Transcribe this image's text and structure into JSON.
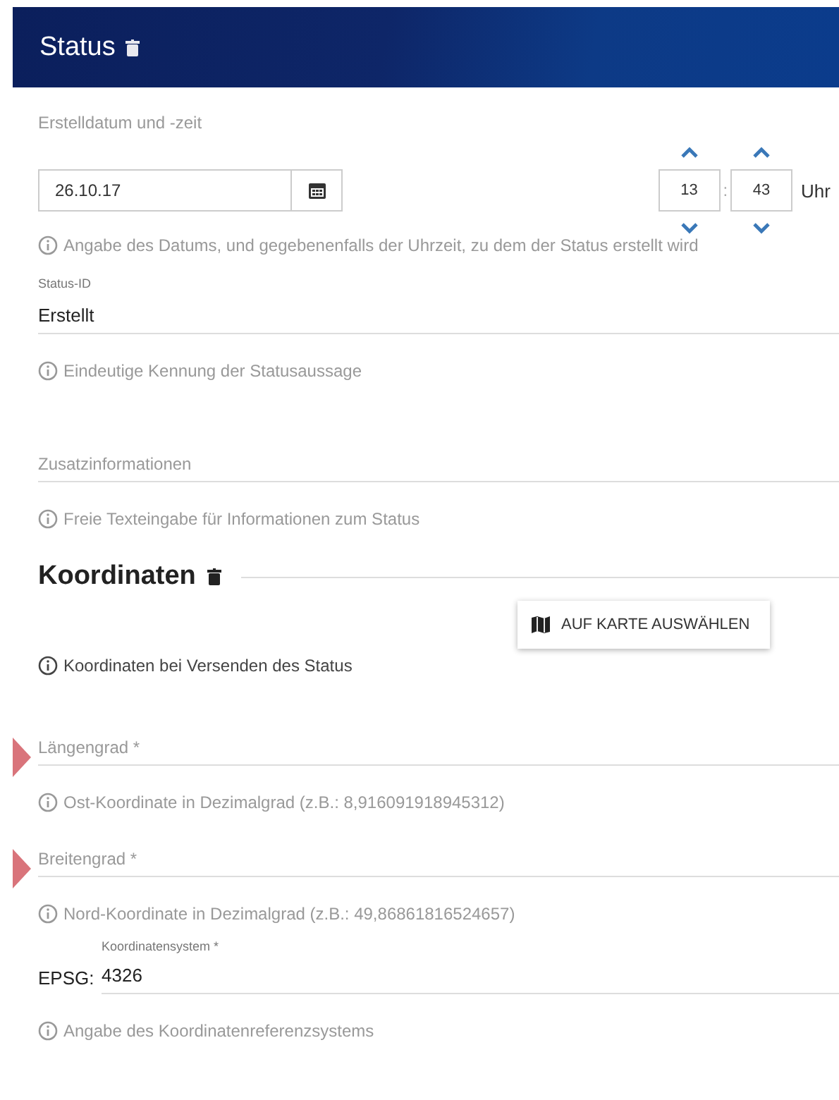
{
  "header": {
    "title": "Status"
  },
  "fields": [
    {
      "kind": "datetime",
      "label": "Erstelldatum und -zeit",
      "date": "26.10.17",
      "hour": "13",
      "separator": ":",
      "minute": "43",
      "unit": "Uhr",
      "hint": "Angabe des Datums, und gegebenenfalls der Uhrzeit, zu dem der Status erstellt wird"
    },
    {
      "kind": "text",
      "label": "Status-ID",
      "value": "Erstellt",
      "invalid": false,
      "hint": "Eindeutige Kennung der Statusaussage"
    },
    {
      "kind": "text",
      "placeholder": "Zusatzinformationen",
      "invalid": false,
      "hint": "Freie Texteingabe für Informationen zum Status"
    },
    {
      "kind": "section",
      "title": "Koordinaten",
      "button": "AUF KARTE AUSWÄHLEN",
      "hint": "Koordinaten bei Versenden des Status"
    },
    {
      "kind": "text",
      "placeholder": "Längengrad *",
      "invalid": true,
      "hint": "Ost-Koordinate in Dezimalgrad (z.B.: 8,916091918945312)"
    },
    {
      "kind": "text",
      "placeholder": "Breitengrad *",
      "invalid": true,
      "hint": "Nord-Koordinate in Dezimalgrad (z.B.: 49,86861816524657)"
    },
    {
      "kind": "prefixed",
      "prefix": "EPSG:",
      "label": "Koordinatensystem *",
      "value": "4326",
      "hint": "Angabe des Koordinatenreferenzsystems"
    }
  ]
}
